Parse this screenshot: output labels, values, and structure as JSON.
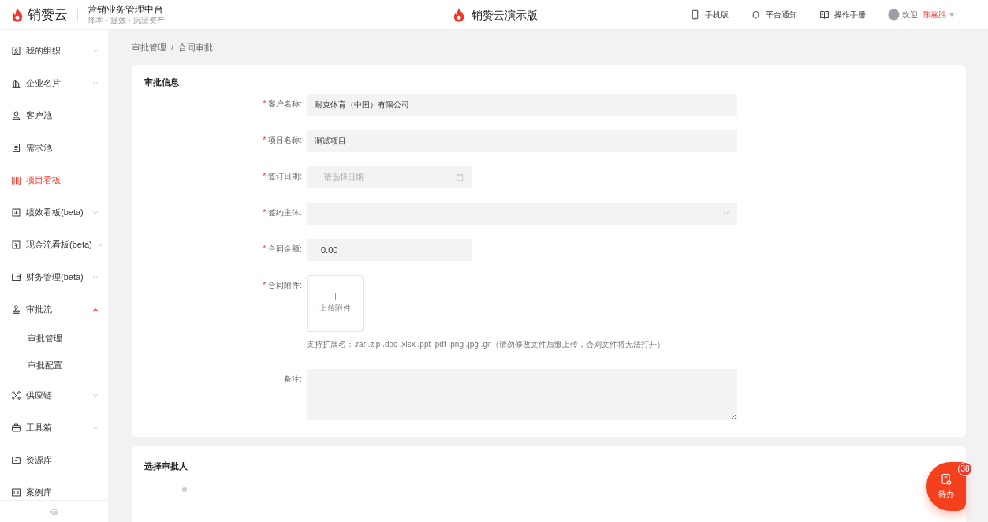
{
  "header": {
    "brand": "销赞云",
    "system_title": "营销业务管理中台",
    "slogan": "降本 · 提效 · 沉淀资产",
    "center_title": "销赞云演示版",
    "links": [
      {
        "kind": "phone",
        "label": "手机版"
      },
      {
        "kind": "bell",
        "label": "平台通知"
      },
      {
        "kind": "book",
        "label": "操作手册"
      }
    ],
    "welcome": "欢迎,",
    "user_name": "陈嘉胜"
  },
  "sidebar": {
    "items": [
      {
        "kind": "group",
        "label": "我的组织",
        "selected": false,
        "expanded": false
      },
      {
        "kind": "group",
        "label": "企业名片",
        "selected": false,
        "expanded": false
      },
      {
        "kind": "link",
        "label": "客户池",
        "selected": false
      },
      {
        "kind": "link",
        "label": "需求池",
        "selected": false
      },
      {
        "kind": "link",
        "label": "项目看板",
        "selected": true
      },
      {
        "kind": "group",
        "label": "绩效看板(beta)",
        "selected": false,
        "expanded": false
      },
      {
        "kind": "group",
        "label": "现金流看板(beta)",
        "selected": false,
        "expanded": false
      },
      {
        "kind": "group",
        "label": "财务管理(beta)",
        "selected": false,
        "expanded": false
      },
      {
        "kind": "group",
        "label": "审批流",
        "selected": false,
        "expanded": true,
        "children": [
          {
            "label": "审批管理",
            "selected": false
          },
          {
            "label": "审批配置",
            "selected": false
          }
        ]
      },
      {
        "kind": "group",
        "label": "供应链",
        "selected": false,
        "expanded": false
      },
      {
        "kind": "group",
        "label": "工具箱",
        "selected": false,
        "expanded": false
      },
      {
        "kind": "link",
        "label": "资源库",
        "selected": false
      },
      {
        "kind": "link",
        "label": "案例库",
        "selected": false
      }
    ]
  },
  "breadcrumb": {
    "items": [
      "审批管理",
      "合同审批"
    ],
    "separator": "/"
  },
  "form": {
    "title": "审批信息",
    "fields": [
      {
        "kind": "text",
        "label": "客户名称:",
        "required_mark": "*",
        "value": "耐克体育（中国）有限公司"
      },
      {
        "kind": "text",
        "label": "项目名称:",
        "required_mark": "*",
        "value": "测试项目"
      },
      {
        "kind": "date",
        "label": "签订日期:",
        "required_mark": "*",
        "placeholder": "请选择日期"
      },
      {
        "kind": "select",
        "label": "签约主体:",
        "required_mark": "*"
      },
      {
        "kind": "number",
        "label": "合同金额:",
        "required_mark": "*",
        "value": "0.00"
      },
      {
        "kind": "upload",
        "label": "合同附件:",
        "required_mark": "*",
        "button": "上传附件",
        "hint": "支持扩展名：.rar .zip .doc .xlsx .ppt .pdf .png .jpg .gif（请勿修改文件后缀上传，否则文件将无法打开）"
      },
      {
        "kind": "textarea",
        "label": "备注:"
      }
    ]
  },
  "approvers": {
    "title": "选择审批人"
  },
  "todo": {
    "label": "待办",
    "count": "38"
  }
}
